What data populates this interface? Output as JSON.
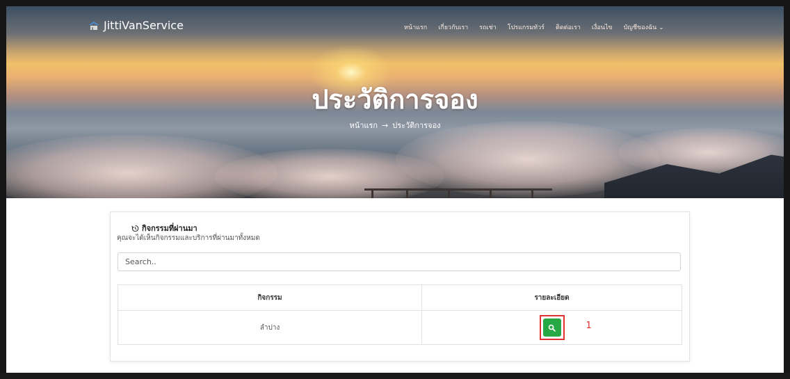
{
  "nav": {
    "brand": "JittiVanService",
    "items": [
      "หน้าแรก",
      "เกี่ยวกับเรา",
      "รถเช่า",
      "โปรแกรมทัวร์",
      "ติดต่อเรา",
      "เงื่อนไข",
      "บัญชีของฉัน ⌄"
    ]
  },
  "hero": {
    "title": "ประวัติการจอง",
    "breadcrumb": {
      "home": "หน้าแรก",
      "arrow": "→",
      "current": "ประวัติการจอง"
    }
  },
  "card": {
    "title": "กิจกรรมที่ผ่านมา",
    "title_icon": "history-icon",
    "subtitle": "คุณจะได้เห็นกิจกรรมและบริการที่ผ่านมาทั้งหมด",
    "search_placeholder": "Search..",
    "table": {
      "headers": [
        "กิจกรรม",
        "รายละเอียด"
      ],
      "rows": [
        {
          "activity": "ลำปาง",
          "detail_icon": "search-icon"
        }
      ]
    },
    "annotation": "1",
    "colors": {
      "button": "#28a745",
      "annotation": "#e03030"
    }
  }
}
